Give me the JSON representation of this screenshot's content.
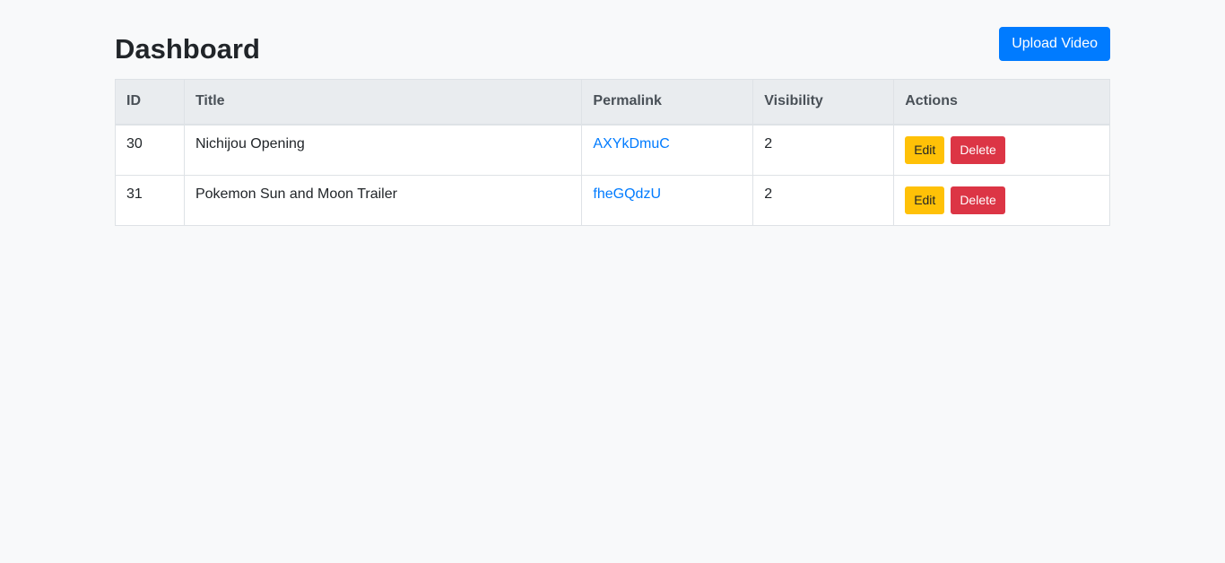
{
  "header": {
    "title": "Dashboard",
    "upload_label": "Upload Video"
  },
  "table": {
    "columns": [
      "ID",
      "Title",
      "Permalink",
      "Visibility",
      "Actions"
    ],
    "rows": [
      {
        "id": "30",
        "title": "Nichijou Opening",
        "permalink": "AXYkDmuC",
        "visibility": "2",
        "edit_label": "Edit",
        "delete_label": "Delete"
      },
      {
        "id": "31",
        "title": "Pokemon Sun and Moon Trailer",
        "permalink": "fheGQdzU",
        "visibility": "2",
        "edit_label": "Edit",
        "delete_label": "Delete"
      }
    ]
  },
  "colors": {
    "primary": "#007bff",
    "warning": "#ffc107",
    "danger": "#dc3545",
    "background": "#f8f9fa",
    "table_header": "#e9ecef"
  }
}
